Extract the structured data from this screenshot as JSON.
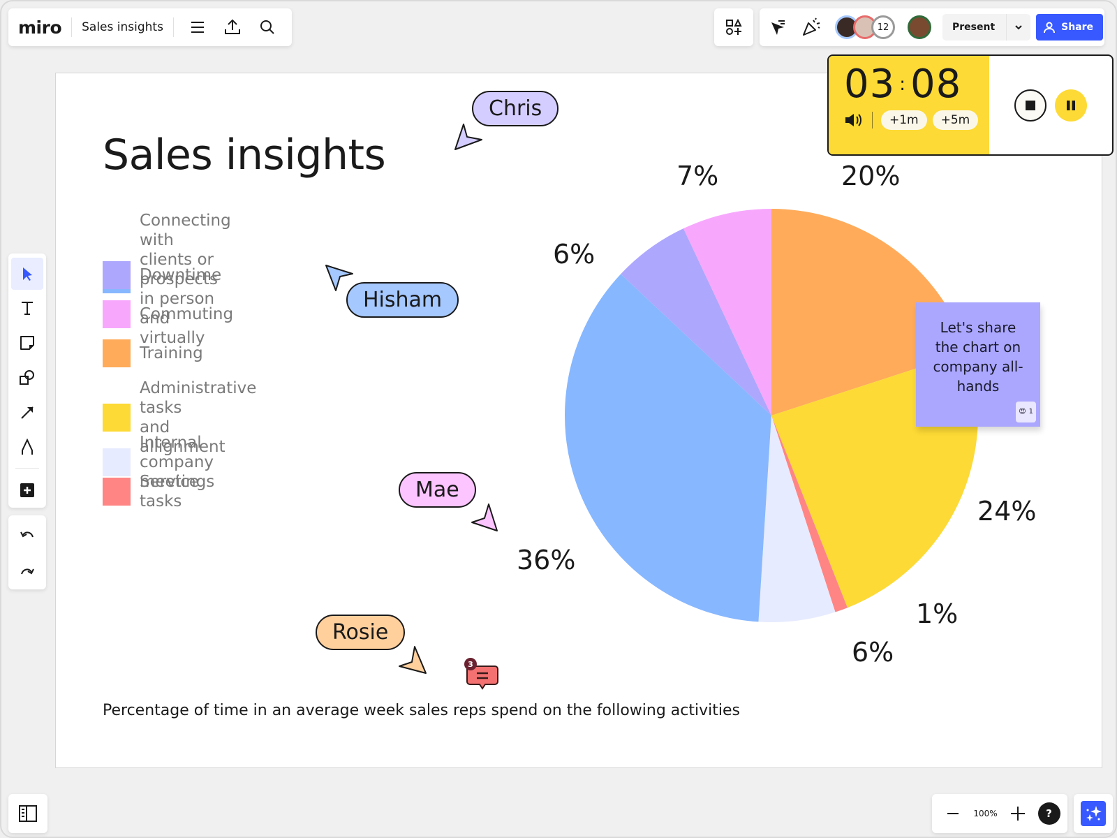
{
  "app": {
    "logo": "miro",
    "board_title": "Sales insights"
  },
  "toolbar": {
    "menu_icon": "hamburger-icon",
    "export_icon": "upload-icon",
    "search_icon": "search-icon"
  },
  "collab": {
    "participants_count": "12",
    "present_label": "Present",
    "share_label": "Share"
  },
  "timer": {
    "minutes": "03",
    "seconds": "08",
    "add_1": "+1m",
    "add_5": "+5m"
  },
  "zoom": {
    "level": "100%",
    "help": "?"
  },
  "board": {
    "title": "Sales insights",
    "caption": "Percentage of time in an average week sales reps spend on the following activities",
    "sticky_note": "Let's share the chart on company all-hands",
    "sticky_reaction_count": "1",
    "comment_count": "3"
  },
  "cursors": [
    {
      "name": "Chris",
      "color": "#d4cdff"
    },
    {
      "name": "Hisham",
      "color": "#a5c8ff"
    },
    {
      "name": "Mae",
      "color": "#fcc5ff"
    },
    {
      "name": "Rosie",
      "color": "#ffcf9c"
    }
  ],
  "chart_data": {
    "type": "pie",
    "title": "Sales insights",
    "subtitle": "Percentage of time in an average week sales reps spend on the following activities",
    "legend_position": "left",
    "start_angle_deg": 0,
    "direction": "clockwise",
    "slices": [
      {
        "label": "Training",
        "value": 20,
        "display": "20%",
        "color": "#ffab5a"
      },
      {
        "label": "Administrative tasks\nand allignment",
        "value": 24,
        "display": "24%",
        "color": "#fdda35"
      },
      {
        "label": "Service tasks",
        "value": 1,
        "display": "1%",
        "color": "#ff8585"
      },
      {
        "label": "Internal company meetings",
        "value": 6,
        "display": "6%",
        "color": "#e7ebff"
      },
      {
        "label": "Connecting with clients or prospects\nin person and virtually",
        "value": 36,
        "display": "36%",
        "color": "#87b7ff"
      },
      {
        "label": "Downtime",
        "value": 6,
        "display": "6%",
        "color": "#ada7fd"
      },
      {
        "label": "Commuting",
        "value": 7,
        "display": "7%",
        "color": "#f7a8fd"
      }
    ],
    "legend_order": [
      4,
      5,
      6,
      0,
      1,
      3,
      2
    ]
  }
}
